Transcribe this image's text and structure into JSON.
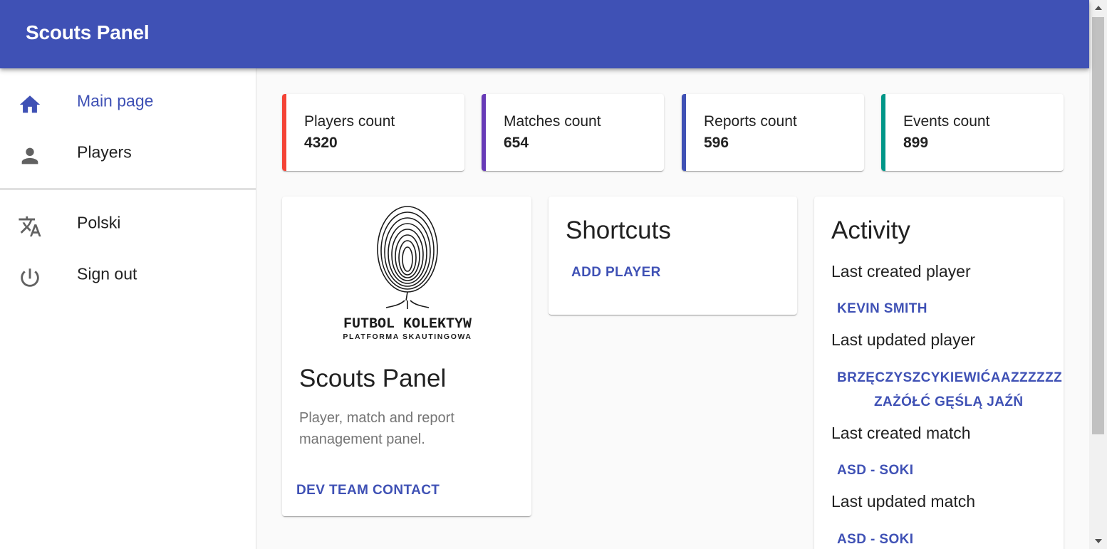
{
  "app": {
    "title": "Scouts Panel"
  },
  "nav": {
    "items": [
      {
        "label": "Main page",
        "icon": "home-icon"
      },
      {
        "label": "Players",
        "icon": "person-icon"
      },
      {
        "label": "Polski",
        "icon": "translate-icon"
      },
      {
        "label": "Sign out",
        "icon": "power-icon"
      }
    ]
  },
  "stats": [
    {
      "label": "Players count",
      "value": "4320",
      "color": "#f44336"
    },
    {
      "label": "Matches count",
      "value": "654",
      "color": "#673ab7"
    },
    {
      "label": "Reports count",
      "value": "596",
      "color": "#3f51b5"
    },
    {
      "label": "Events count",
      "value": "899",
      "color": "#009688"
    }
  ],
  "about": {
    "logo_name": "FUTBOL KOLEKTYW",
    "logo_tagline": "PLATFORMA SKAUTINGOWA",
    "title": "Scouts Panel",
    "description": "Player, match and report management panel.",
    "contact_button": "DEV TEAM CONTACT"
  },
  "shortcuts": {
    "title": "Shortcuts",
    "add_player": "ADD PLAYER"
  },
  "activity": {
    "title": "Activity",
    "last_created_player_label": "Last created player",
    "last_created_player": "KEVIN SMITH",
    "last_updated_player_label": "Last updated player",
    "last_updated_player_line1": "BRZĘCZYSZCYKIEWIĆAAZZZZZZ",
    "last_updated_player_line2": "ZAŻÓŁĆ GĘŚLĄ JAŹŃ",
    "last_created_match_label": "Last created match",
    "last_created_match": "ASD - SOKI",
    "last_updated_match_label": "Last updated match",
    "last_updated_match": "ASD - SOKI"
  },
  "theme": {
    "primary": "#3f51b5"
  }
}
